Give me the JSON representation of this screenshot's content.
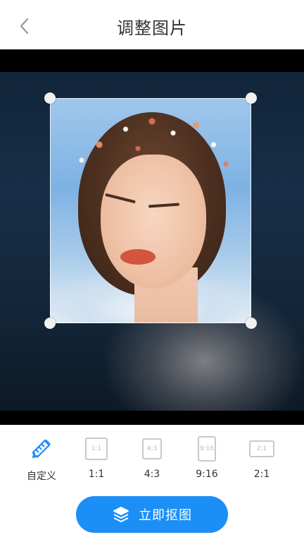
{
  "header": {
    "title": "调整图片",
    "back_icon": "chevron-left-icon"
  },
  "editor": {
    "crop_handles": 4
  },
  "ratios": [
    {
      "id": "custom",
      "label": "自定义",
      "icon": "edit-ruler-icon",
      "selected": true
    },
    {
      "id": "1-1",
      "label": "1:1",
      "icon_text": "1:1",
      "selected": false
    },
    {
      "id": "4-3",
      "label": "4:3",
      "icon_text": "4:3",
      "selected": false
    },
    {
      "id": "9-16",
      "label": "9:16",
      "icon_text": "9:16",
      "selected": false
    },
    {
      "id": "2-1",
      "label": "2:1",
      "icon_text": "2:1",
      "selected": false
    }
  ],
  "action": {
    "label": "立即抠图",
    "icon": "layers-icon"
  },
  "colors": {
    "accent": "#1c8ff7",
    "ratio_border": "#c9c9c9",
    "title": "#333333"
  }
}
